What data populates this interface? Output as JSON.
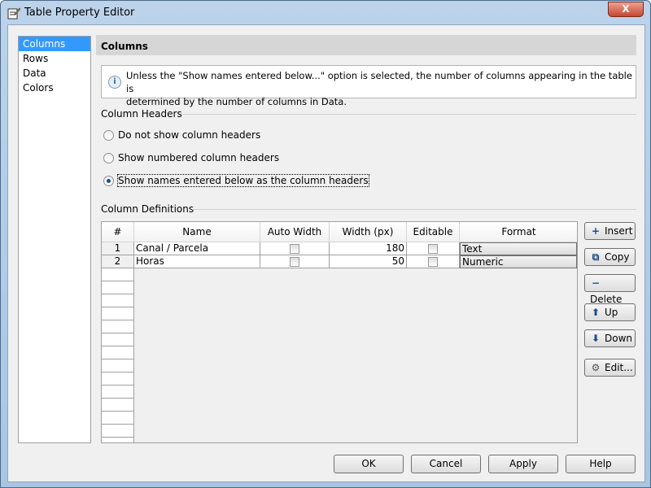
{
  "window": {
    "title": "Table Property Editor",
    "close_label": "X"
  },
  "sidebar": {
    "items": [
      {
        "label": "Columns",
        "selected": true
      },
      {
        "label": "Rows"
      },
      {
        "label": "Data"
      },
      {
        "label": "Colors"
      }
    ]
  },
  "panel": {
    "title": "Columns",
    "info_line1": "Unless the \"Show names entered below...\" option is selected, the number of columns appearing in the table is",
    "info_line2": "determined by the number of columns in Data."
  },
  "column_headers": {
    "label": "Column Headers",
    "options": [
      {
        "label": "Do not show column headers",
        "selected": false
      },
      {
        "label": "Show numbered column headers",
        "selected": false
      },
      {
        "label": "Show names entered below as the column headers",
        "selected": true
      }
    ]
  },
  "column_definitions": {
    "label": "Column Definitions",
    "headers": [
      "#",
      "Name",
      "Auto Width",
      "Width (px)",
      "Editable",
      "Format"
    ],
    "rows": [
      {
        "num": "1",
        "name": "Canal / Parcela",
        "auto_width": false,
        "width": "180",
        "editable": false,
        "format": "Text"
      },
      {
        "num": "2",
        "name": "Horas",
        "auto_width": false,
        "width": "50",
        "editable": false,
        "format": "Numeric"
      }
    ]
  },
  "side_buttons": {
    "insert": "Insert",
    "copy": "Copy",
    "delete": "Delete",
    "up": "Up",
    "down": "Down",
    "edit": "Edit..."
  },
  "footer": {
    "ok": "OK",
    "cancel": "Cancel",
    "apply": "Apply",
    "help": "Help"
  }
}
